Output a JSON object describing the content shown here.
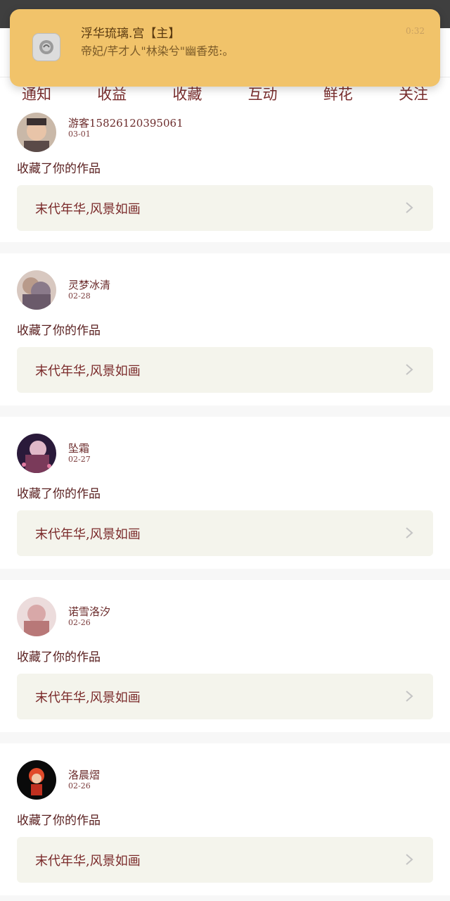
{
  "notification": {
    "title": "浮华琉璃.宫【主】",
    "body": "帝妃/芊才人\"林染兮\"幽香苑:。",
    "time": "0:32",
    "icon": "app-icon"
  },
  "tabs": [
    {
      "label": "通知",
      "active": false
    },
    {
      "label": "收益",
      "active": false
    },
    {
      "label": "收藏",
      "active": true
    },
    {
      "label": "互动",
      "active": false
    },
    {
      "label": "鲜花",
      "active": false
    },
    {
      "label": "关注",
      "active": false
    }
  ],
  "items": [
    {
      "user": "游客15826120395061",
      "date": "03-01",
      "action": "收藏了你的作品",
      "work": "末代年华,风景如画"
    },
    {
      "user": "灵梦冰清",
      "date": "02-28",
      "action": "收藏了你的作品",
      "work": "末代年华,风景如画"
    },
    {
      "user": "坠霜",
      "date": "02-27",
      "action": "收藏了你的作品",
      "work": "末代年华,风景如画"
    },
    {
      "user": "诺雪洛汐",
      "date": "02-26",
      "action": "收藏了你的作品",
      "work": "末代年华,风景如画"
    },
    {
      "user": "洛晨熠",
      "date": "02-26",
      "action": "收藏了你的作品",
      "work": "末代年华,风景如画"
    }
  ],
  "colors": {
    "notification_bg": "#f1c36a",
    "tab_indicator": "#d77aa6",
    "work_box_bg": "#f4f4ec",
    "status_bar": "#3f3f3f"
  }
}
